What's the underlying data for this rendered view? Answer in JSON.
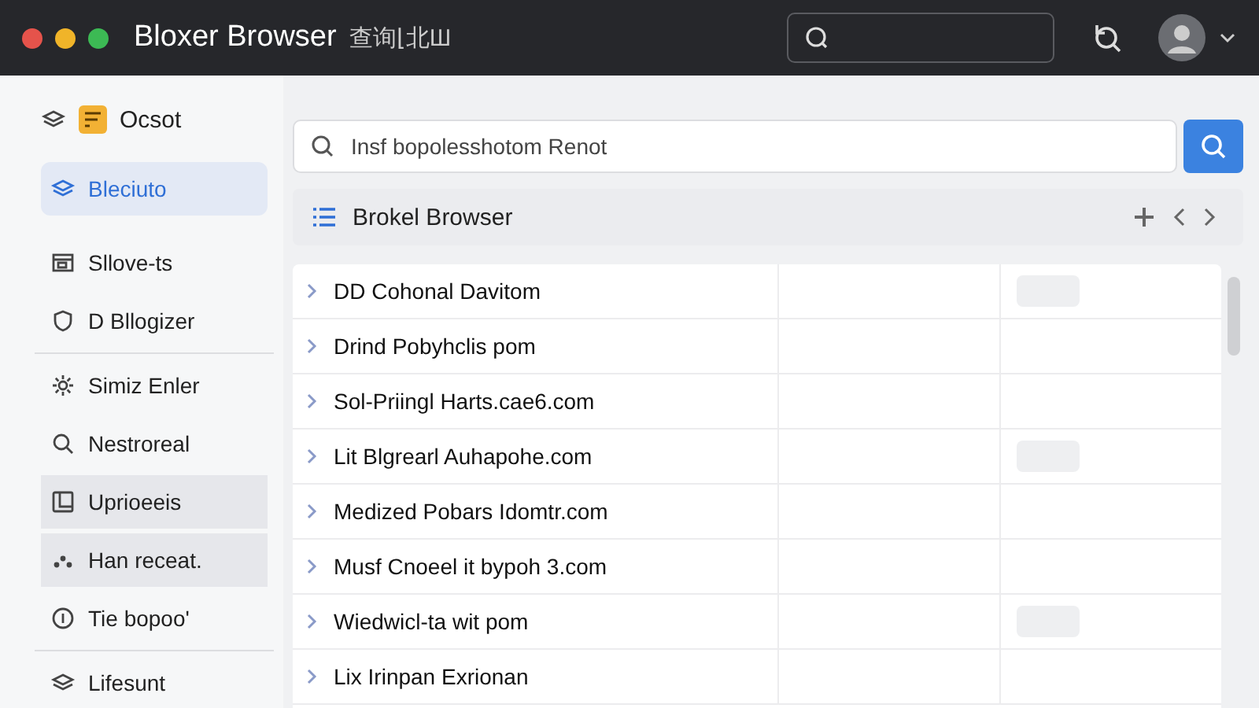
{
  "window": {
    "title": "Bloxer Browser",
    "subtitle": "查询⌊北Ш"
  },
  "sidebar": {
    "header": {
      "label": "Ocsot"
    },
    "sections": [
      {
        "items": [
          {
            "label": "Bleciuto",
            "selected": true,
            "shaded": false
          },
          {
            "label": "Sllove-ts",
            "selected": false,
            "shaded": false
          },
          {
            "label": "D Bllogizer",
            "selected": false,
            "shaded": false
          }
        ]
      },
      {
        "items": [
          {
            "label": "Simiz Enler",
            "selected": false,
            "shaded": false
          },
          {
            "label": "Nestroreal",
            "selected": false,
            "shaded": false
          },
          {
            "label": "Uprioeeis",
            "selected": false,
            "shaded": true
          },
          {
            "label": "Han receat.",
            "selected": false,
            "shaded": true
          },
          {
            "label": "Tie bopoo'",
            "selected": false,
            "shaded": false
          }
        ]
      },
      {
        "items": [
          {
            "label": "Lifesunt",
            "selected": false,
            "shaded": false
          }
        ]
      }
    ]
  },
  "search": {
    "value": "Insf bopolesshotom Renot"
  },
  "list": {
    "title": "Brokel Browser",
    "rows": [
      {
        "name": "DD Cohonal Davitom",
        "tag": true
      },
      {
        "name": "Drind Pobyhclis pom",
        "tag": false
      },
      {
        "name": "Sol-Priingl Harts.cae6.com",
        "tag": false
      },
      {
        "name": "Lit Blgrearl Auhapohe.com",
        "tag": true
      },
      {
        "name": "Medized Pobars Idomtr.com",
        "tag": false
      },
      {
        "name": "Musf Cnoeel it bypoh 3.com",
        "tag": false
      },
      {
        "name": "Wiedwicl-ta wit pom",
        "tag": true
      },
      {
        "name": "Lix Irinpan Exrionan",
        "tag": false
      }
    ]
  }
}
